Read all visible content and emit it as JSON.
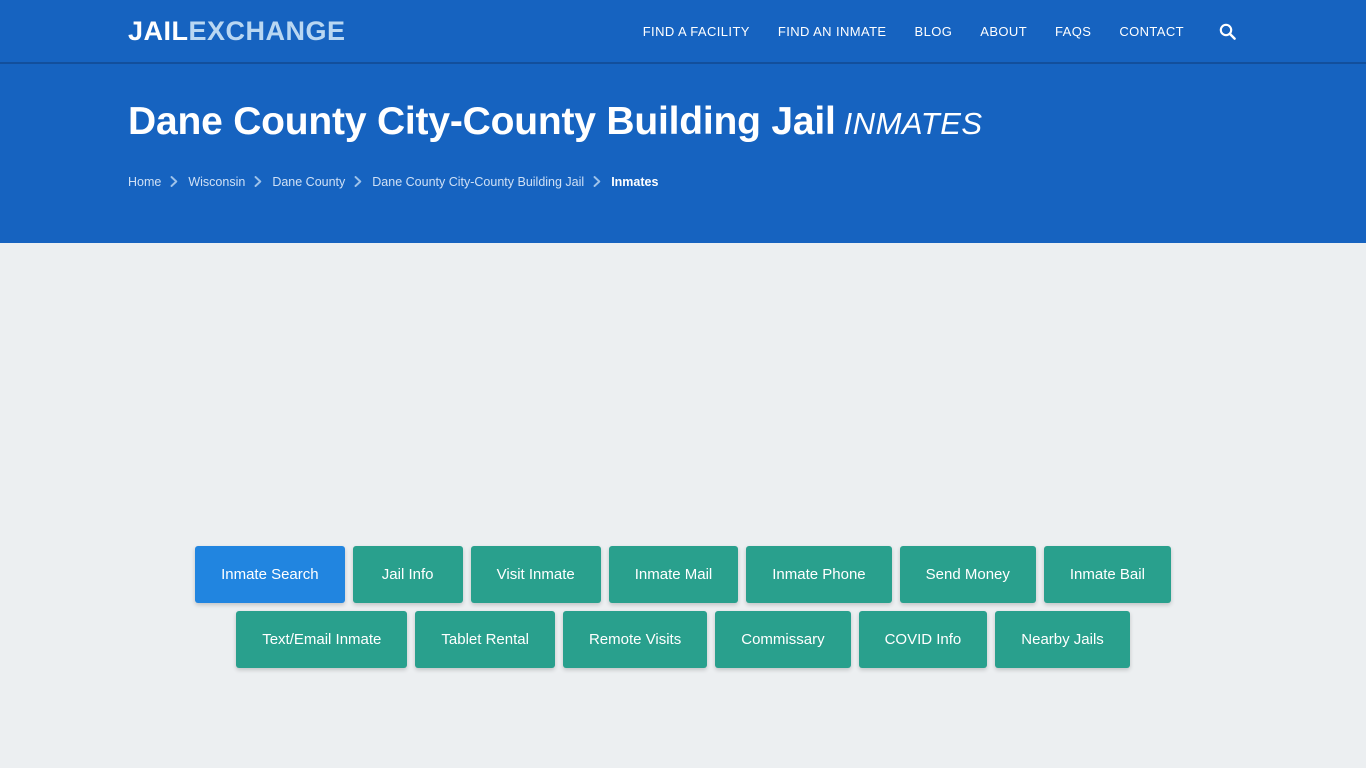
{
  "header": {
    "logo": {
      "part1": "JAIL",
      "part2": "EXCHANGE"
    },
    "nav": [
      {
        "label": "FIND A FACILITY"
      },
      {
        "label": "FIND AN INMATE"
      },
      {
        "label": "BLOG"
      },
      {
        "label": "ABOUT"
      },
      {
        "label": "FAQs"
      },
      {
        "label": "CONTACT"
      }
    ],
    "search_icon": "search-icon"
  },
  "hero": {
    "title": "Dane County City-County Building Jail",
    "title_suffix": "INMATES",
    "breadcrumb": [
      {
        "label": "Home",
        "current": false
      },
      {
        "label": "Wisconsin",
        "current": false
      },
      {
        "label": "Dane County",
        "current": false
      },
      {
        "label": "Dane County City-County Building Jail",
        "current": false
      },
      {
        "label": "Inmates",
        "current": true
      }
    ]
  },
  "main": {
    "tabs_row1": [
      {
        "label": "Inmate Search",
        "active": true
      },
      {
        "label": "Jail Info",
        "active": false
      },
      {
        "label": "Visit Inmate",
        "active": false
      },
      {
        "label": "Inmate Mail",
        "active": false
      },
      {
        "label": "Inmate Phone",
        "active": false
      },
      {
        "label": "Send Money",
        "active": false
      },
      {
        "label": "Inmate Bail",
        "active": false
      }
    ],
    "tabs_row2": [
      {
        "label": "Text/Email Inmate",
        "active": false
      },
      {
        "label": "Tablet Rental",
        "active": false
      },
      {
        "label": "Remote Visits",
        "active": false
      },
      {
        "label": "Commissary",
        "active": false
      },
      {
        "label": "COVID Info",
        "active": false
      },
      {
        "label": "Nearby Jails",
        "active": false
      }
    ]
  },
  "colors": {
    "brand_blue": "#1663c0",
    "nav_border": "#124f9c",
    "teal": "#29a08d",
    "active_blue": "#2185e0",
    "page_bg": "#eceff1",
    "logo_accent": "#b9d7f2"
  }
}
